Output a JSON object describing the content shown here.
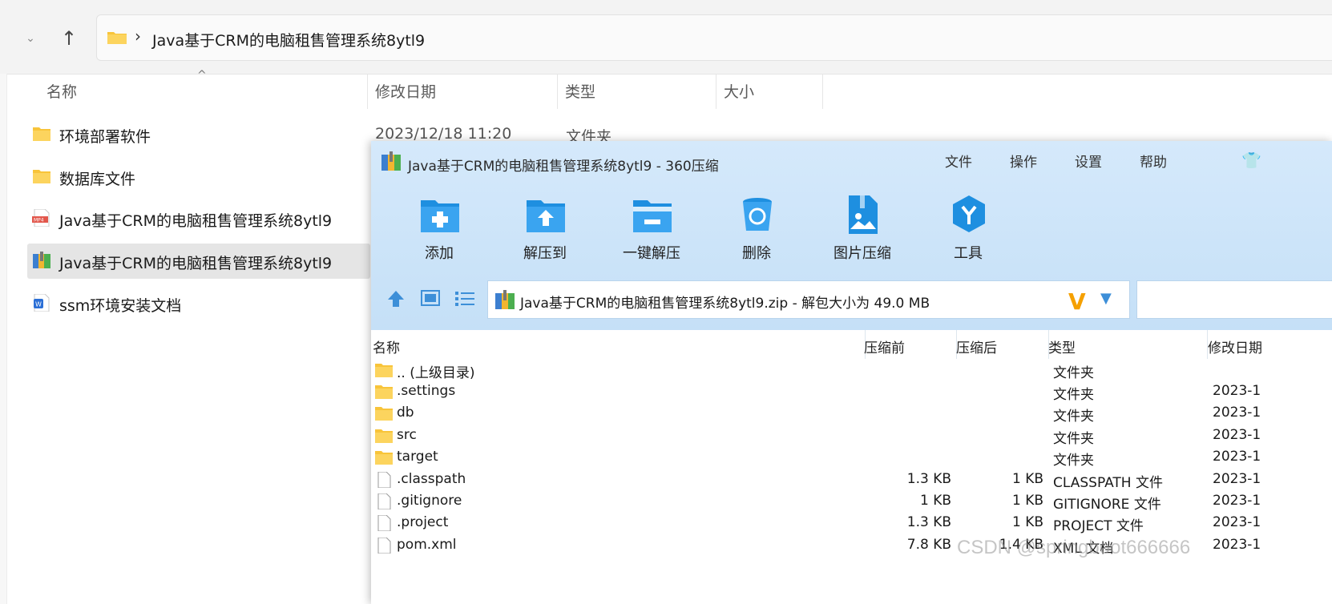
{
  "explorer": {
    "address_path": "Java基于CRM的电脑租售管理系统8ytl9",
    "columns": {
      "name": "名称",
      "date": "修改日期",
      "type": "类型",
      "size": "大小"
    },
    "rows": [
      {
        "label": "环境部署软件",
        "date": "2023/12/18 11:20",
        "type": "文件夹",
        "icon": "folder-icon"
      },
      {
        "label": "数据库文件",
        "date": "",
        "type": "",
        "icon": "folder-icon"
      },
      {
        "label": "Java基于CRM的电脑租售管理系统8ytl9",
        "date": "",
        "type": "",
        "icon": "mp4-file-icon"
      },
      {
        "label": "Java基于CRM的电脑租售管理系统8ytl9",
        "date": "",
        "type": "",
        "icon": "zip-archive-icon"
      },
      {
        "label": "ssm环境安装文档",
        "date": "",
        "type": "",
        "icon": "word-doc-icon"
      }
    ]
  },
  "zip": {
    "title": "Java基于CRM的电脑租售管理系统8ytl9 - 360压缩",
    "menu": [
      "文件",
      "操作",
      "设置",
      "帮助"
    ],
    "tools": [
      "添加",
      "解压到",
      "一键解压",
      "删除",
      "图片压缩",
      "工具"
    ],
    "address": "Java基于CRM的电脑租售管理系统8ytl9.zip - 解包大小为 49.0 MB",
    "columns": {
      "name": "名称",
      "before": "压缩前",
      "after": "压缩后",
      "type": "类型",
      "modified": "修改日期"
    },
    "rows": [
      {
        "name": ".. (上级目录)",
        "before": "",
        "after": "",
        "type": "文件夹",
        "date": "",
        "kind": "folder"
      },
      {
        "name": ".settings",
        "before": "",
        "after": "",
        "type": "文件夹",
        "date": "2023-1",
        "kind": "folder"
      },
      {
        "name": "db",
        "before": "",
        "after": "",
        "type": "文件夹",
        "date": "2023-1",
        "kind": "folder"
      },
      {
        "name": "src",
        "before": "",
        "after": "",
        "type": "文件夹",
        "date": "2023-1",
        "kind": "folder"
      },
      {
        "name": "target",
        "before": "",
        "after": "",
        "type": "文件夹",
        "date": "2023-1",
        "kind": "folder"
      },
      {
        "name": ".classpath",
        "before": "1.3 KB",
        "after": "1 KB",
        "type": "CLASSPATH 文件",
        "date": "2023-1",
        "kind": "file"
      },
      {
        "name": ".gitignore",
        "before": "1 KB",
        "after": "1 KB",
        "type": "GITIGNORE 文件",
        "date": "2023-1",
        "kind": "file"
      },
      {
        "name": ".project",
        "before": "1.3 KB",
        "after": "1 KB",
        "type": "PROJECT 文件",
        "date": "2023-1",
        "kind": "file"
      },
      {
        "name": "pom.xml",
        "before": "7.8 KB",
        "after": "1.4 KB",
        "type": "XML 文档",
        "date": "2023-1",
        "kind": "file"
      }
    ]
  },
  "watermark": "CSDN @springboot666666",
  "colors": {
    "zip_header": "#cfe6fa",
    "tool_blue": "#1e8fe0",
    "folder_yellow": "#f8c43a",
    "selected_row": "#e5e5e5"
  }
}
